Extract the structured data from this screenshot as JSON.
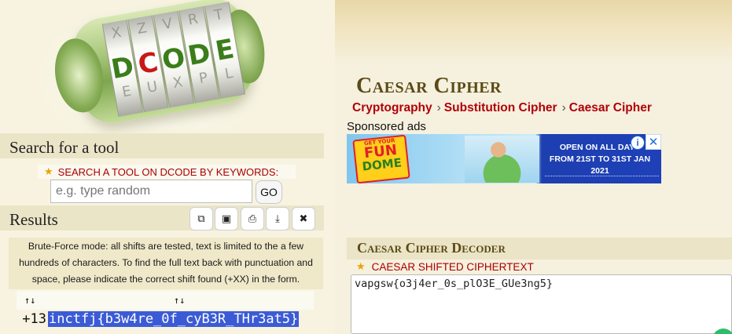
{
  "logo": {
    "dials": [
      {
        "up": "X",
        "mid": "D",
        "low": "E"
      },
      {
        "up": "Z",
        "mid": "C",
        "low": "U"
      },
      {
        "up": "V",
        "mid": "O",
        "low": "X"
      },
      {
        "up": "R",
        "mid": "D",
        "low": "P"
      },
      {
        "up": "T",
        "mid": "E",
        "low": "L"
      }
    ],
    "colors": {
      "green": "#3b7d1a",
      "red": "#c81818"
    }
  },
  "search": {
    "header": "Search for a tool",
    "keywords_label": "SEARCH A TOOL ON DCODE BY KEYWORDS:",
    "placeholder": "e.g. type random",
    "go_label": "GO"
  },
  "results": {
    "header": "Results",
    "toolbar_icons": [
      "copy-icon",
      "save-icon",
      "print-icon",
      "download-icon",
      "close-icon"
    ],
    "note": "Brute-Force mode: all shifts are tested, text is limited to the a few hundreds of characters. To find the full text back with punctuation and space, please indicate the correct shift found (+XX) in the form.",
    "sort_left": "↑↓",
    "sort_right": "↑↓",
    "row": {
      "shift": "+13",
      "text": "inctfj{b3w4re_0f_cyB3R_THr3at5}"
    }
  },
  "page": {
    "title": "Caesar Cipher",
    "breadcrumbs": [
      "Cryptography",
      "Substitution Cipher",
      "Caesar Cipher"
    ],
    "breadcrumb_sep": "›",
    "sponsored": "Sponsored ads"
  },
  "ad": {
    "badge_top": "GET YOUR",
    "badge_mid": "FUN",
    "badge_bottom": "DOME",
    "line1": "OPEN ON ALL DAYS",
    "line2": "FROM 21ST TO 31ST JAN 2021",
    "info": "i",
    "close": "✕"
  },
  "decoder": {
    "header": "Caesar Cipher Decoder",
    "ciphertext_label": "CAESAR SHIFTED CIPHERTEXT",
    "ciphertext": "vapgsw{o3j4er_0s_plO3E_GUe3ng5}"
  },
  "colors": {
    "accent_red": "#b0000b",
    "title_brown": "#5a4a16",
    "selection": "#3b5bd6"
  }
}
